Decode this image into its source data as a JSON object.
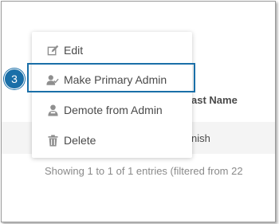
{
  "table": {
    "column_header": "ast Name",
    "row_cell": "nish",
    "info": "Showing 1 to 1 of 1 entries (filtered from 22"
  },
  "menu": {
    "items": [
      {
        "label": "Edit",
        "icon": "edit-icon"
      },
      {
        "label": "Make Primary Admin",
        "icon": "user-check-icon"
      },
      {
        "label": "Demote from Admin",
        "icon": "user-demote-icon"
      },
      {
        "label": "Delete",
        "icon": "trash-icon"
      }
    ]
  },
  "callout": {
    "step_number": "3"
  },
  "colors": {
    "accent": "#1a6fa8",
    "text": "#4a4a4a",
    "icon": "#8f8f8f"
  }
}
